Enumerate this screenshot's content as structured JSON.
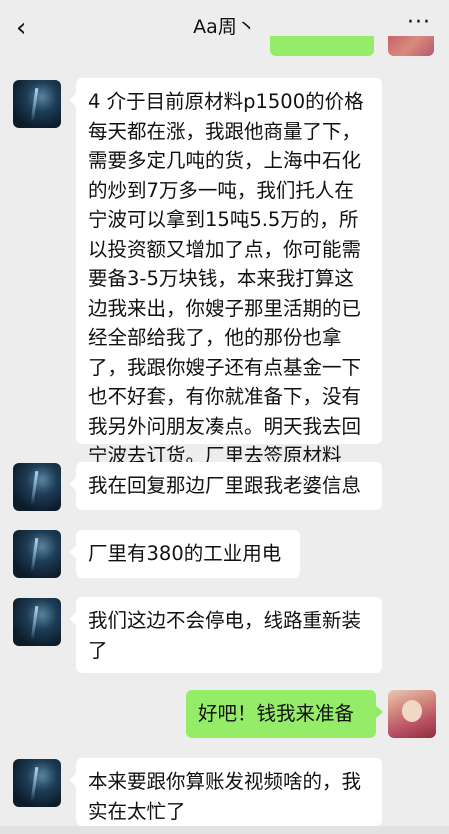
{
  "header": {
    "back_icon": "‹",
    "title": "Aa周丶",
    "more_icon": "···"
  },
  "messages": [
    {
      "sender": "contact",
      "text": "4 介于目前原材料p1500的价格\n每天都在涨，我跟他商量了下，\n需要多定几吨的货，上海中石化\n的炒到7万多一吨，我们托人在\n宁波可以拿到15吨5.5万的，所\n以投资额又增加了点，你可能需\n要备3-5万块钱，本来我打算这\n边我来出，你嫂子那里活期的已\n经全部给我了，他的那份也拿\n了，我跟你嫂子还有点基金一下\n也不好套，有你就准备下，没有\n我另外问朋友凑点。明天我去回\n宁波去订货。厂里去签原材料"
    },
    {
      "sender": "contact",
      "text": "我在回复那边厂里跟我老婆信息"
    },
    {
      "sender": "contact",
      "text": "厂里有380的工业用电"
    },
    {
      "sender": "contact",
      "text": "我们这边不会停电，线路重新装\n了"
    },
    {
      "sender": "me",
      "text": "好吧！钱我来准备"
    },
    {
      "sender": "contact",
      "text": "本来要跟你算账发视频啥的，我\n实在太忙了"
    }
  ]
}
